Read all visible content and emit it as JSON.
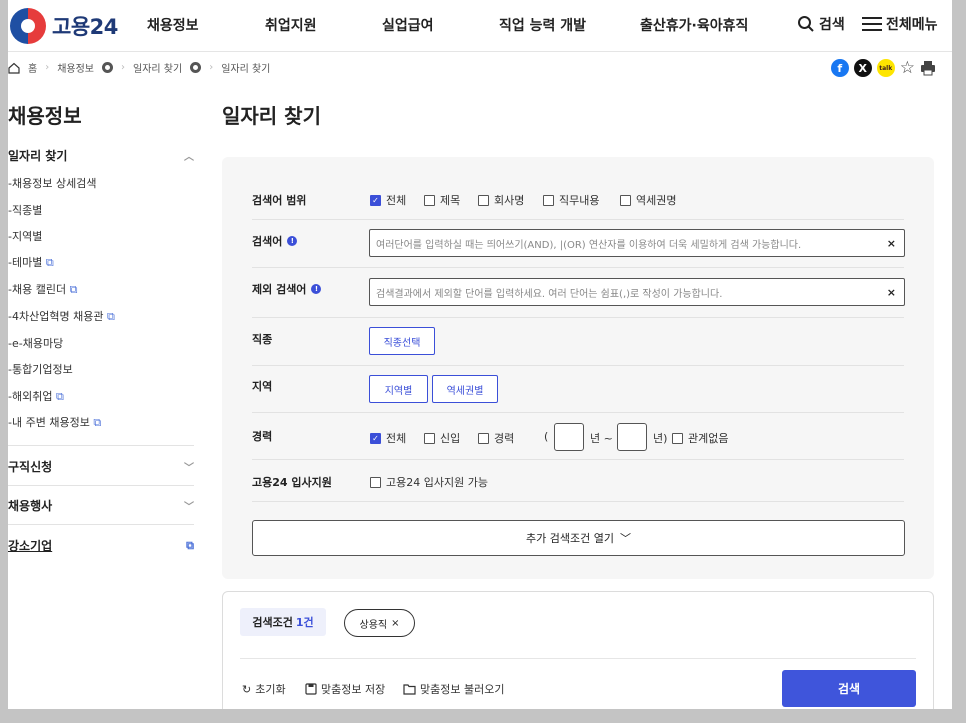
{
  "header": {
    "logo_text": "고용24",
    "nav": [
      "채용정보",
      "취업지원",
      "실업급여",
      "직업 능력 개발",
      "출산휴가·육아휴직"
    ],
    "search_label": "검색",
    "menu_label": "전체메뉴"
  },
  "breadcrumb": {
    "home": "홈",
    "level1": "채용정보",
    "level2": "일자리 찾기",
    "level3": "일자리 찾기"
  },
  "share": {
    "facebook": "f",
    "x": "X",
    "kakao": "talk"
  },
  "sidebar": {
    "title": "채용정보",
    "section1": "일자리 찾기",
    "items": [
      {
        "label": "채용정보 상세검색",
        "ext": false
      },
      {
        "label": "직종별",
        "ext": false
      },
      {
        "label": "지역별",
        "ext": false
      },
      {
        "label": "테마별",
        "ext": true
      },
      {
        "label": "채용 캘린더",
        "ext": true
      },
      {
        "label": "4차산업혁명 채용관",
        "ext": true
      },
      {
        "label": "e-채용마당",
        "ext": false
      },
      {
        "label": "통합기업정보",
        "ext": false
      },
      {
        "label": "해외취업",
        "ext": true
      },
      {
        "label": "내 주변 채용정보",
        "ext": true
      }
    ],
    "section2": "구직신청",
    "section3": "채용행사",
    "section4": "강소기업"
  },
  "main": {
    "title": "일자리 찾기",
    "scope_label": "검색어 범위",
    "scope_options": [
      {
        "label": "전체",
        "checked": true
      },
      {
        "label": "제목",
        "checked": false
      },
      {
        "label": "회사명",
        "checked": false
      },
      {
        "label": "직무내용",
        "checked": false
      },
      {
        "label": "역세권명",
        "checked": false
      }
    ],
    "keyword_label": "검색어",
    "keyword_placeholder": "여러단어를 입력하실 때는 띄어쓰기(AND), |(OR) 연산자를 이용하여 더욱 세밀하게 검색 가능합니다.",
    "exclude_label": "제외 검색어",
    "exclude_placeholder": "검색결과에서 제외할 단어를 입력하세요. 여러 단어는 쉼표(,)로 작성이 가능합니다.",
    "job_label": "직종",
    "job_btn": "직종선택",
    "region_label": "지역",
    "region_btn1": "지역별",
    "region_btn2": "역세권별",
    "career_label": "경력",
    "career_options": [
      {
        "label": "전체",
        "checked": true
      },
      {
        "label": "신입",
        "checked": false
      },
      {
        "label": "경력",
        "checked": false
      }
    ],
    "career_open_paren": "(",
    "career_year_from": "년 ~",
    "career_year_to": "년)",
    "career_any": "관계없음",
    "support_label": "고용24 입사지원",
    "support_option": "고용24 입사지원 가능",
    "more_btn": "추가 검색조건 열기"
  },
  "conditions": {
    "label": "검색조건",
    "count": "1건",
    "tag": "상용직",
    "reset": "초기화",
    "save": "맞춤정보 저장",
    "load": "맞춤정보 불러오기",
    "search_btn": "검색"
  },
  "colors": {
    "accent": "#3b4fd8",
    "logo": "#1f3a77"
  }
}
